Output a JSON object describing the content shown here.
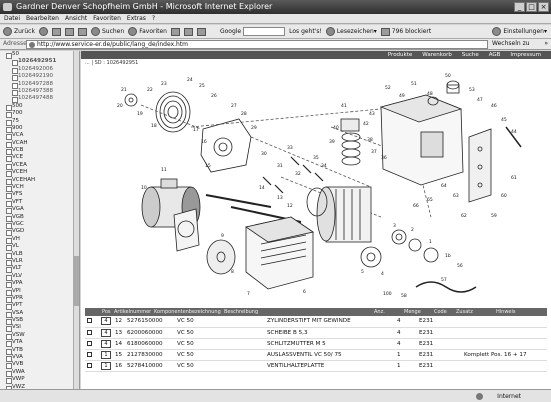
{
  "window": {
    "title": "Gardner Denver Schopfheim GmbH - Microsoft Internet Explorer"
  },
  "menu": [
    "Datei",
    "Bearbeiten",
    "Ansicht",
    "Favoriten",
    "Extras",
    "?"
  ],
  "toolbar": {
    "back": "Zurück",
    "search": "Suchen",
    "favorites": "Favoriten",
    "google": "Google",
    "search_web": "Los geht's!",
    "bookmarks": "Lesezeichen▾",
    "blocked": "796 blockiert",
    "settings": "Einstellungen▾"
  },
  "address": {
    "label": "Adresse",
    "url": "http://www.service-er.de/public/lang_de/index.htm",
    "go": "Wechseln zu",
    "links": "»"
  },
  "sidebar": {
    "items": [
      {
        "label": "50",
        "sub": false
      },
      {
        "label": "1026492951",
        "sub": true,
        "selected": true
      },
      {
        "label": "1026492006",
        "sub": true
      },
      {
        "label": "1026492190",
        "sub": true
      },
      {
        "label": "1026497288",
        "sub": true
      },
      {
        "label": "1026497388",
        "sub": true
      },
      {
        "label": "1026497488",
        "sub": true
      },
      {
        "label": "500",
        "sub": false
      },
      {
        "label": "700",
        "sub": false
      },
      {
        "label": "75",
        "sub": false
      },
      {
        "label": "900",
        "sub": false
      },
      {
        "label": "VCA",
        "sub": false
      },
      {
        "label": "VCAH",
        "sub": false
      },
      {
        "label": "VCB",
        "sub": false
      },
      {
        "label": "VCE",
        "sub": false
      },
      {
        "label": "VCEA",
        "sub": false
      },
      {
        "label": "VCEH",
        "sub": false
      },
      {
        "label": "VCEHAH",
        "sub": false
      },
      {
        "label": "VCH",
        "sub": false
      },
      {
        "label": "VFS",
        "sub": false
      },
      {
        "label": "VFT",
        "sub": false
      },
      {
        "label": "VGA",
        "sub": false
      },
      {
        "label": "VGB",
        "sub": false
      },
      {
        "label": "VGC",
        "sub": false
      },
      {
        "label": "VGD",
        "sub": false
      },
      {
        "label": "VH",
        "sub": false
      },
      {
        "label": "VL",
        "sub": false
      },
      {
        "label": "VLB",
        "sub": false
      },
      {
        "label": "VLR",
        "sub": false
      },
      {
        "label": "VLT",
        "sub": false
      },
      {
        "label": "VLV",
        "sub": false
      },
      {
        "label": "VPA",
        "sub": false
      },
      {
        "label": "VPI",
        "sub": false
      },
      {
        "label": "VPR",
        "sub": false
      },
      {
        "label": "VPT",
        "sub": false
      },
      {
        "label": "VSA",
        "sub": false
      },
      {
        "label": "VSB",
        "sub": false
      },
      {
        "label": "VSI",
        "sub": false
      },
      {
        "label": "VSW",
        "sub": false
      },
      {
        "label": "VTA",
        "sub": false
      },
      {
        "label": "VTB",
        "sub": false
      },
      {
        "label": "VVA",
        "sub": false
      },
      {
        "label": "VVB",
        "sub": false
      },
      {
        "label": "VWA",
        "sub": false
      },
      {
        "label": "VWP",
        "sub": false
      },
      {
        "label": "VWZ",
        "sub": false
      },
      {
        "label": "WKP",
        "sub": false
      }
    ]
  },
  "nav": [
    "Produkte",
    "Warenkorb",
    "Suche",
    "AGB",
    "Impressum"
  ],
  "breadcrumb": "... | SD : 1026492951",
  "parts": {
    "header": [
      "",
      "Pos",
      "Artikelnummer",
      "Komponentenbezeichnung",
      "Beschreibung",
      "",
      "Anz.",
      "Menge",
      "Code",
      "Zusatz",
      "Hinweis"
    ],
    "rows": [
      {
        "qty_box": "4",
        "pos": "12",
        "article": "5276150000",
        "type": "VC 50",
        "desc": "ZYLINDERSTIFT MIT GEWINDE",
        "count": "4",
        "code": "E231",
        "note": ""
      },
      {
        "qty_box": "4",
        "pos": "13",
        "article": "6200060000",
        "type": "VC 50",
        "desc": "SCHEIBE B 5,3",
        "count": "4",
        "code": "E231",
        "note": ""
      },
      {
        "qty_box": "4",
        "pos": "14",
        "article": "6180060000",
        "type": "VC 50",
        "desc": "SCHLITZMUTTER M 5",
        "count": "4",
        "code": "E231",
        "note": ""
      },
      {
        "qty_box": "1",
        "pos": "15",
        "article": "2127830000",
        "type": "VC 50",
        "desc": "AUSLASSVENTIL VC 50/ 75",
        "count": "1",
        "code": "E231",
        "note": "Komplett Pos. 16 + 17"
      },
      {
        "qty_box": "1",
        "pos": "16",
        "article": "5278410000",
        "type": "VC 50",
        "desc": "VENTILHALTEPLATTE",
        "count": "1",
        "code": "E231",
        "note": ""
      }
    ]
  },
  "drawing_labels": [
    "52",
    "51",
    "50",
    "53",
    "49",
    "48",
    "47",
    "46",
    "45",
    "44",
    "43",
    "42",
    "41",
    "40",
    "39",
    "38",
    "37",
    "36",
    "35",
    "34",
    "33",
    "32",
    "31",
    "30",
    "29",
    "28",
    "27",
    "26",
    "25",
    "24",
    "23",
    "22",
    "21",
    "20",
    "19",
    "18",
    "17",
    "16",
    "15",
    "14",
    "13",
    "12",
    "11",
    "10",
    "9",
    "8",
    "7",
    "6",
    "5",
    "4",
    "3",
    "2",
    "1",
    "1b",
    "56",
    "57",
    "58",
    "59",
    "60",
    "61",
    "62",
    "63",
    "64",
    "65",
    "66",
    "100"
  ],
  "status": {
    "zone": "Internet"
  }
}
